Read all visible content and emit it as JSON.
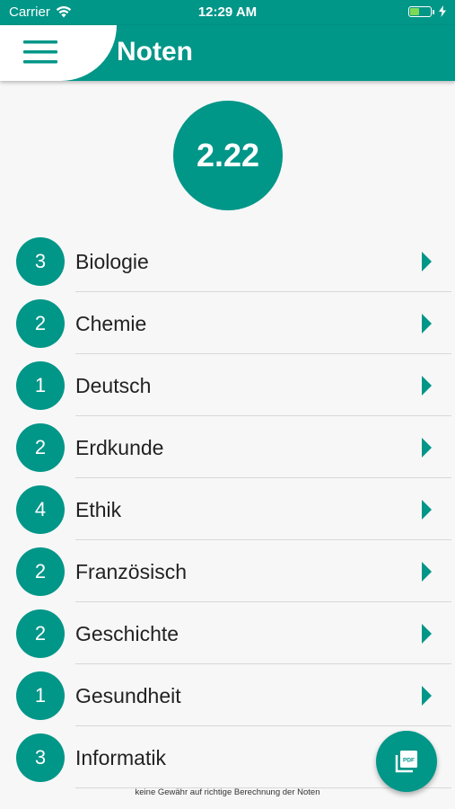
{
  "status_bar": {
    "carrier": "Carrier",
    "time": "12:29 AM"
  },
  "header": {
    "title": "Noten"
  },
  "average": "2.22",
  "subjects": [
    {
      "grade": "3",
      "name": "Biologie"
    },
    {
      "grade": "2",
      "name": "Chemie"
    },
    {
      "grade": "1",
      "name": "Deutsch"
    },
    {
      "grade": "2",
      "name": "Erdkunde"
    },
    {
      "grade": "4",
      "name": "Ethik"
    },
    {
      "grade": "2",
      "name": "Französisch"
    },
    {
      "grade": "2",
      "name": "Geschichte"
    },
    {
      "grade": "1",
      "name": "Gesundheit"
    },
    {
      "grade": "3",
      "name": "Informatik"
    }
  ],
  "fab": {
    "icon": "pdf-icon",
    "label": "PDF"
  },
  "disclaimer": "keine Gewähr auf richtige Berechnung der Noten",
  "colors": {
    "accent": "#009688",
    "background": "#f7f7f7"
  }
}
